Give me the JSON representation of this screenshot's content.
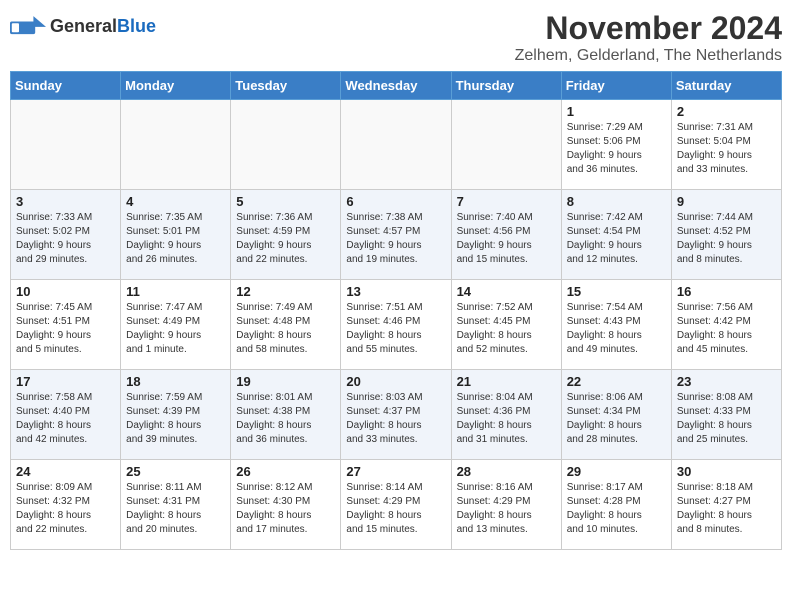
{
  "logo": {
    "general": "General",
    "blue": "Blue"
  },
  "header": {
    "month": "November 2024",
    "location": "Zelhem, Gelderland, The Netherlands"
  },
  "weekdays": [
    "Sunday",
    "Monday",
    "Tuesday",
    "Wednesday",
    "Thursday",
    "Friday",
    "Saturday"
  ],
  "weeks": [
    [
      {
        "day": "",
        "info": ""
      },
      {
        "day": "",
        "info": ""
      },
      {
        "day": "",
        "info": ""
      },
      {
        "day": "",
        "info": ""
      },
      {
        "day": "",
        "info": ""
      },
      {
        "day": "1",
        "info": "Sunrise: 7:29 AM\nSunset: 5:06 PM\nDaylight: 9 hours\nand 36 minutes."
      },
      {
        "day": "2",
        "info": "Sunrise: 7:31 AM\nSunset: 5:04 PM\nDaylight: 9 hours\nand 33 minutes."
      }
    ],
    [
      {
        "day": "3",
        "info": "Sunrise: 7:33 AM\nSunset: 5:02 PM\nDaylight: 9 hours\nand 29 minutes."
      },
      {
        "day": "4",
        "info": "Sunrise: 7:35 AM\nSunset: 5:01 PM\nDaylight: 9 hours\nand 26 minutes."
      },
      {
        "day": "5",
        "info": "Sunrise: 7:36 AM\nSunset: 4:59 PM\nDaylight: 9 hours\nand 22 minutes."
      },
      {
        "day": "6",
        "info": "Sunrise: 7:38 AM\nSunset: 4:57 PM\nDaylight: 9 hours\nand 19 minutes."
      },
      {
        "day": "7",
        "info": "Sunrise: 7:40 AM\nSunset: 4:56 PM\nDaylight: 9 hours\nand 15 minutes."
      },
      {
        "day": "8",
        "info": "Sunrise: 7:42 AM\nSunset: 4:54 PM\nDaylight: 9 hours\nand 12 minutes."
      },
      {
        "day": "9",
        "info": "Sunrise: 7:44 AM\nSunset: 4:52 PM\nDaylight: 9 hours\nand 8 minutes."
      }
    ],
    [
      {
        "day": "10",
        "info": "Sunrise: 7:45 AM\nSunset: 4:51 PM\nDaylight: 9 hours\nand 5 minutes."
      },
      {
        "day": "11",
        "info": "Sunrise: 7:47 AM\nSunset: 4:49 PM\nDaylight: 9 hours\nand 1 minute."
      },
      {
        "day": "12",
        "info": "Sunrise: 7:49 AM\nSunset: 4:48 PM\nDaylight: 8 hours\nand 58 minutes."
      },
      {
        "day": "13",
        "info": "Sunrise: 7:51 AM\nSunset: 4:46 PM\nDaylight: 8 hours\nand 55 minutes."
      },
      {
        "day": "14",
        "info": "Sunrise: 7:52 AM\nSunset: 4:45 PM\nDaylight: 8 hours\nand 52 minutes."
      },
      {
        "day": "15",
        "info": "Sunrise: 7:54 AM\nSunset: 4:43 PM\nDaylight: 8 hours\nand 49 minutes."
      },
      {
        "day": "16",
        "info": "Sunrise: 7:56 AM\nSunset: 4:42 PM\nDaylight: 8 hours\nand 45 minutes."
      }
    ],
    [
      {
        "day": "17",
        "info": "Sunrise: 7:58 AM\nSunset: 4:40 PM\nDaylight: 8 hours\nand 42 minutes."
      },
      {
        "day": "18",
        "info": "Sunrise: 7:59 AM\nSunset: 4:39 PM\nDaylight: 8 hours\nand 39 minutes."
      },
      {
        "day": "19",
        "info": "Sunrise: 8:01 AM\nSunset: 4:38 PM\nDaylight: 8 hours\nand 36 minutes."
      },
      {
        "day": "20",
        "info": "Sunrise: 8:03 AM\nSunset: 4:37 PM\nDaylight: 8 hours\nand 33 minutes."
      },
      {
        "day": "21",
        "info": "Sunrise: 8:04 AM\nSunset: 4:36 PM\nDaylight: 8 hours\nand 31 minutes."
      },
      {
        "day": "22",
        "info": "Sunrise: 8:06 AM\nSunset: 4:34 PM\nDaylight: 8 hours\nand 28 minutes."
      },
      {
        "day": "23",
        "info": "Sunrise: 8:08 AM\nSunset: 4:33 PM\nDaylight: 8 hours\nand 25 minutes."
      }
    ],
    [
      {
        "day": "24",
        "info": "Sunrise: 8:09 AM\nSunset: 4:32 PM\nDaylight: 8 hours\nand 22 minutes."
      },
      {
        "day": "25",
        "info": "Sunrise: 8:11 AM\nSunset: 4:31 PM\nDaylight: 8 hours\nand 20 minutes."
      },
      {
        "day": "26",
        "info": "Sunrise: 8:12 AM\nSunset: 4:30 PM\nDaylight: 8 hours\nand 17 minutes."
      },
      {
        "day": "27",
        "info": "Sunrise: 8:14 AM\nSunset: 4:29 PM\nDaylight: 8 hours\nand 15 minutes."
      },
      {
        "day": "28",
        "info": "Sunrise: 8:16 AM\nSunset: 4:29 PM\nDaylight: 8 hours\nand 13 minutes."
      },
      {
        "day": "29",
        "info": "Sunrise: 8:17 AM\nSunset: 4:28 PM\nDaylight: 8 hours\nand 10 minutes."
      },
      {
        "day": "30",
        "info": "Sunrise: 8:18 AM\nSunset: 4:27 PM\nDaylight: 8 hours\nand 8 minutes."
      }
    ]
  ]
}
